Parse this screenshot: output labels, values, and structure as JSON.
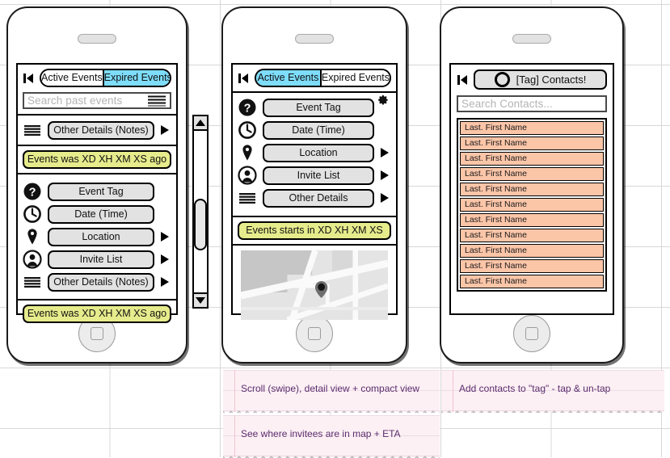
{
  "colors": {
    "accent_cyan": "#7dddfa",
    "banner_yellow": "#e6eb8c",
    "contact_salmon": "#fbc5a8",
    "pill_gray": "#e2e2e2",
    "note_pink": "#fdf0f4",
    "note_text": "#5a2d6e"
  },
  "phone1": {
    "name": "expired-events-list-screen",
    "tabs": [
      {
        "label": "Active Events",
        "selected": false
      },
      {
        "label": "Expired Events",
        "selected": true
      }
    ],
    "search": {
      "placeholder": "Search past events"
    },
    "compact_row": {
      "label": "Other Details (Notes)",
      "icon": "lines-icon",
      "chevron": true
    },
    "banner_top": "Events was XD XH XM XS ago",
    "detail_rows": [
      {
        "icon": "question-mark-icon",
        "label": "Event Tag",
        "chevron": false
      },
      {
        "icon": "clock-icon",
        "label": "Date (Time)",
        "chevron": false
      },
      {
        "icon": "map-pin-icon",
        "label": "Location",
        "chevron": true
      },
      {
        "icon": "person-icon",
        "label": "Invite List",
        "chevron": true
      },
      {
        "icon": "lines-icon",
        "label": "Other Details (Notes)",
        "chevron": true
      }
    ],
    "banner_bottom": "Events was XD XH XM XS ago"
  },
  "scrollbar": {
    "name": "vertical-scrollbar",
    "up_arrow": "scroll-up-icon",
    "down_arrow": "scroll-down-icon"
  },
  "phone2": {
    "name": "active-event-detail-screen",
    "tabs": [
      {
        "label": "Active Events",
        "selected": true
      },
      {
        "label": "Expired Events",
        "selected": false
      }
    ],
    "settings_icon": "gear-icon",
    "detail_rows": [
      {
        "icon": "question-mark-icon",
        "label": "Event Tag",
        "chevron": false
      },
      {
        "icon": "clock-icon",
        "label": "Date (Time)",
        "chevron": false
      },
      {
        "icon": "map-pin-icon",
        "label": "Location",
        "chevron": true
      },
      {
        "icon": "person-icon",
        "label": "Invite List",
        "chevron": true
      },
      {
        "icon": "lines-icon",
        "label": "Other Details",
        "chevron": true
      }
    ],
    "banner": "Events starts in XD XH XM XS",
    "map": {
      "name": "location-map",
      "marker": "map-pin-marker"
    }
  },
  "phone3": {
    "name": "tag-contacts-screen",
    "title": "[Tag] Contacts!",
    "title_icon": "circle-icon",
    "back_icon": "back-icon",
    "search": {
      "placeholder": "Search Contacts..."
    },
    "contacts": [
      "Last. First Name",
      "Last. First Name",
      "Last. First Name",
      "Last. First Name",
      "Last. First Name",
      "Last. First Name",
      "Last. First Name",
      "Last. First Name",
      "Last. First Name",
      "Last. First Name",
      "Last. First Name"
    ]
  },
  "notes": [
    {
      "text": "Scroll (swipe), detail view + compact view"
    },
    {
      "text": "Add contacts to \"tag\" - tap & un-tap"
    },
    {
      "text": "See where invitees are in map + ETA"
    }
  ]
}
